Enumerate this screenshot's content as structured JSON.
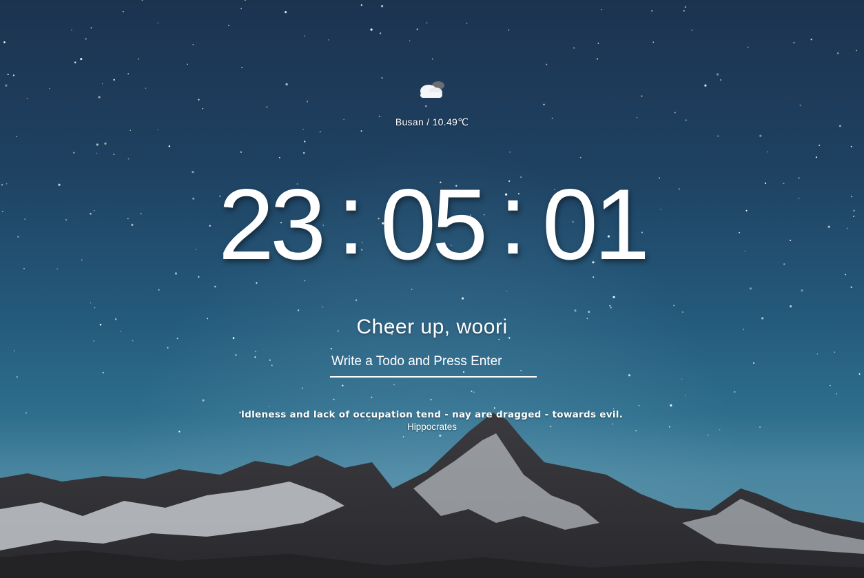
{
  "weather": {
    "icon": "cloud-icon",
    "text": "Busan / 10.49℃"
  },
  "clock": {
    "hours": "23",
    "minutes": "05",
    "seconds": "01",
    "separator": ":"
  },
  "greeting": "Cheer up, woori",
  "todo": {
    "placeholder": "Write a Todo and Press Enter",
    "value": ""
  },
  "quote": {
    "text": "Idleness and lack of occupation tend - nay are dragged - towards evil.",
    "author": "Hippocrates"
  },
  "background": {
    "image": "starry-night-mountains",
    "colors": {
      "sky_top": "#1c3350",
      "sky_bottom": "#5d8fa6",
      "text": "#ffffff"
    }
  }
}
